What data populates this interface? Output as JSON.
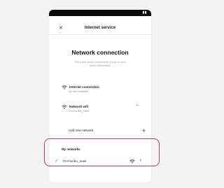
{
  "header": {
    "close_icon": "x-close-icon",
    "title": "Internet service"
  },
  "main": {
    "title": "Network connection",
    "subtitle": "You'll find which connection youre on and more information"
  },
  "internet_connection": {
    "icon": "wifi-icon",
    "title": "Internet connection",
    "status": "No sim installed"
  },
  "network_wifi": {
    "icon": "wifi-icon",
    "title": "Network wifi",
    "current": "CH-honbu_main",
    "expand_icon": "chevron-up-icon"
  },
  "add_network": {
    "label": "Add new network",
    "icon": "plus-icon"
  },
  "my_networks": {
    "heading": "My networks",
    "items": [
      {
        "name": "CH-honbu_main",
        "connected_icon": "checkmark-icon",
        "signal_icon": "wifi-icon",
        "open_icon": "chevron-right-icon"
      }
    ]
  },
  "colors": {
    "highlight": "#b03a7c",
    "connected": "#3aa676",
    "status_bar": "#0c0c0c"
  }
}
